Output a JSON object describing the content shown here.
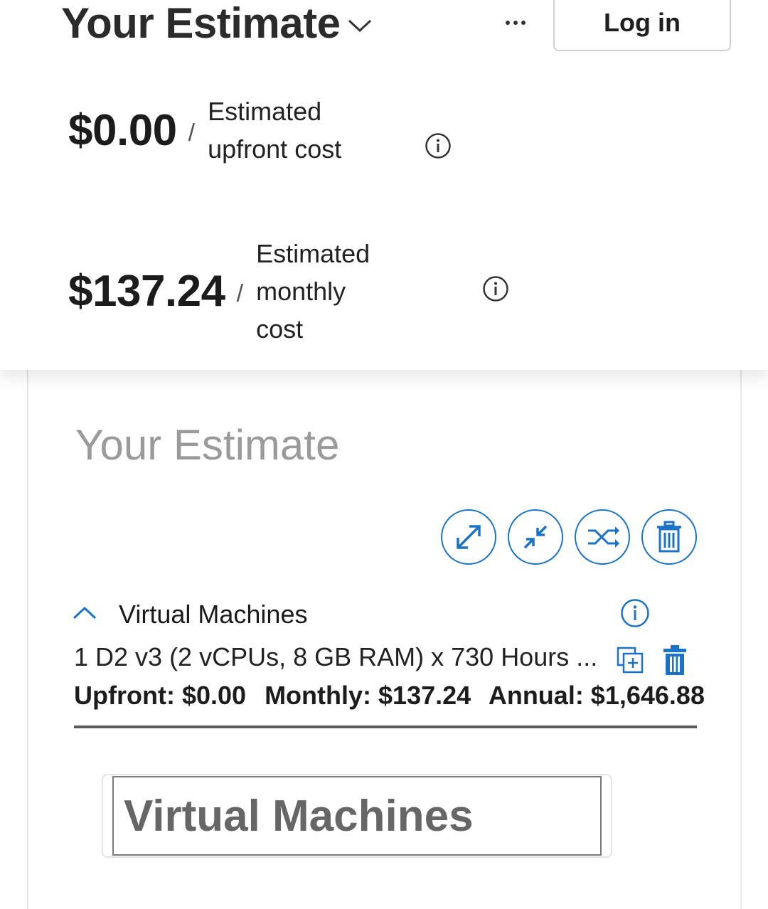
{
  "header": {
    "title": "Your Estimate",
    "login_label": "Log in"
  },
  "costs": {
    "upfront": {
      "amount": "$0.00",
      "separator": "/",
      "label": "Estimated upfront cost"
    },
    "monthly": {
      "amount": "$137.24",
      "separator": "/",
      "label": "Estimated monthly cost"
    }
  },
  "card": {
    "title": "Your Estimate",
    "actions": [
      "expand-all-icon",
      "collapse-all-icon",
      "shuffle-icon",
      "trash-icon"
    ]
  },
  "service": {
    "name": "Virtual Machines",
    "description": "1 D2 v3 (2 vCPUs, 8 GB RAM) x 730 Hours ...",
    "upfront": "Upfront: $0.00",
    "monthly": "Monthly: $137.24",
    "annual": "Annual: $1,646.88",
    "input_value": "Virtual Machines"
  },
  "colors": {
    "accent": "#1a73c8",
    "muted_title": "#9a9a9a"
  }
}
